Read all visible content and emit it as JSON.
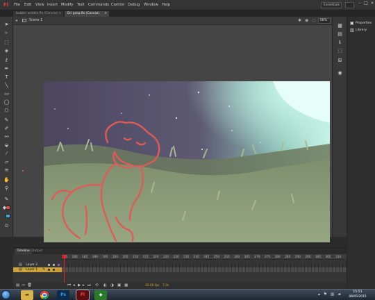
{
  "app": {
    "logo": "Fl"
  },
  "menu": [
    "File",
    "Edit",
    "View",
    "Insert",
    "Modify",
    "Text",
    "Commands",
    "Control",
    "Debug",
    "Window",
    "Help"
  ],
  "workspace": {
    "label": "Essentials"
  },
  "tabs": [
    {
      "label": "bubble wobble.fla (Canvas)",
      "close": "×"
    },
    {
      "label": "Dri gasp.fla (Canvas)",
      "close": "×"
    }
  ],
  "editbar": {
    "scene": "Scene 1",
    "zoom": "68%"
  },
  "right_panel": {
    "items": [
      "Properties",
      "Library"
    ]
  },
  "timeline": {
    "tabs": [
      "Timeline",
      "Output"
    ],
    "ruler": [
      "175",
      "180",
      "185",
      "190",
      "195",
      "200",
      "205",
      "210",
      "215",
      "220",
      "225",
      "230",
      "235",
      "240",
      "245",
      "250",
      "255",
      "260",
      "265",
      "270",
      "275",
      "280",
      "285",
      "290",
      "295",
      "300",
      "305",
      "310"
    ],
    "layers": [
      "Layer 2",
      "Layer 1"
    ],
    "fps": "25.00 fps",
    "time": "7.0s"
  },
  "taskbar": {
    "time": "15:51",
    "date": "08/05/2015"
  },
  "colors": {
    "stroke": "#e74b46",
    "fill": "#44aadd",
    "accent": "#e23333"
  }
}
